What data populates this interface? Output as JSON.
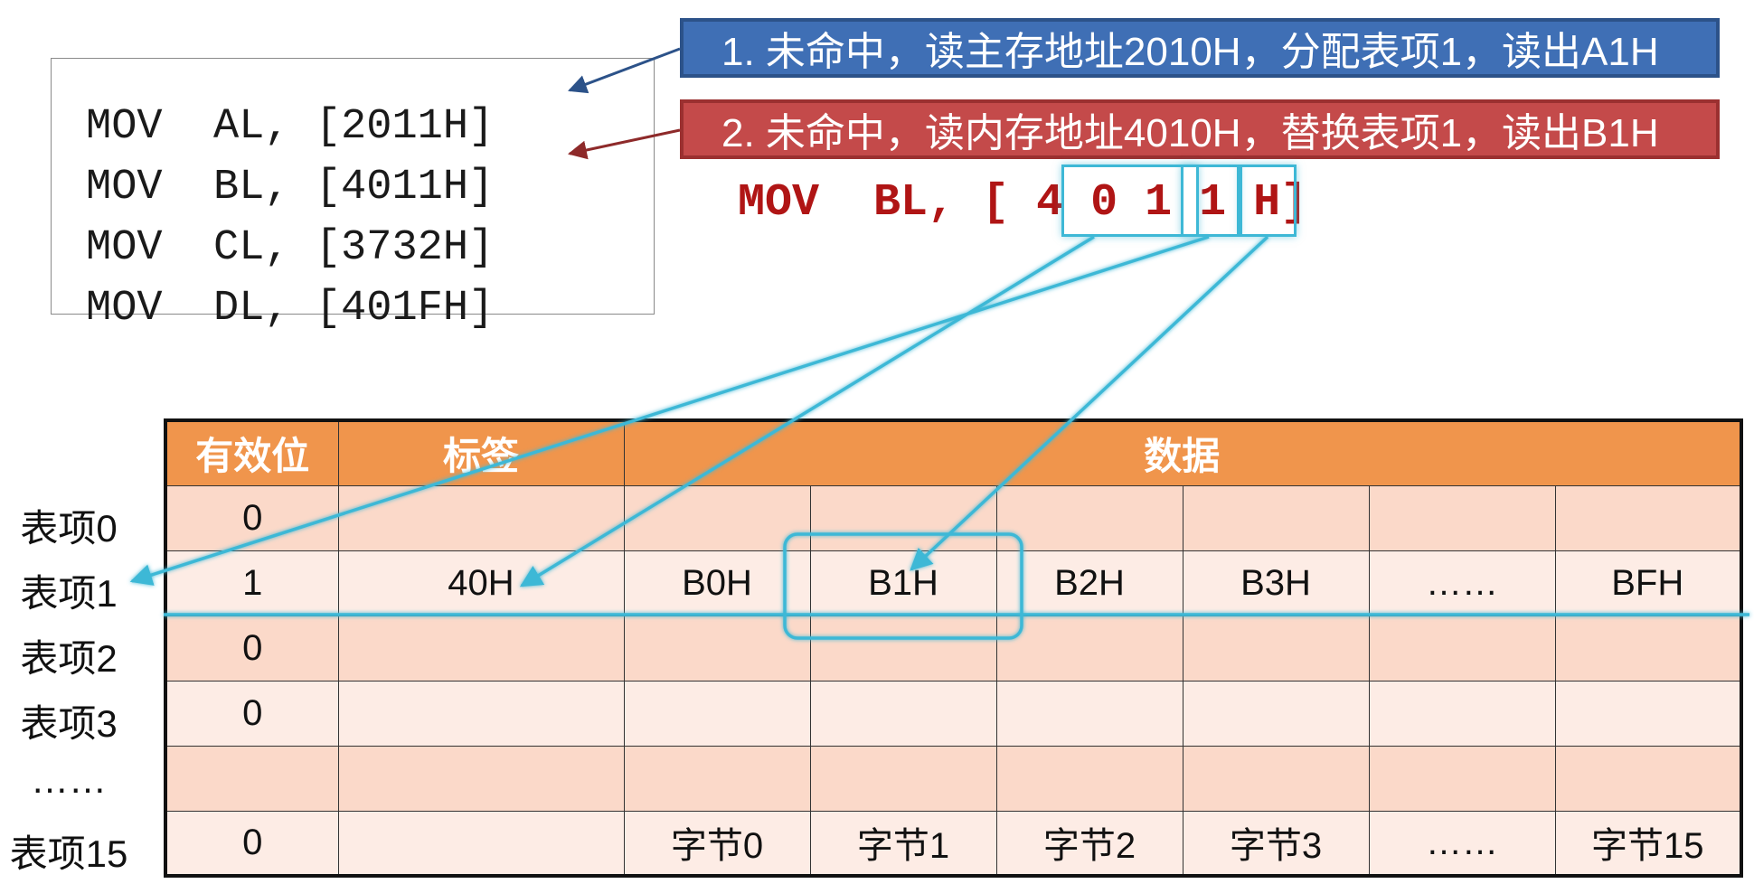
{
  "code_lines": [
    "MOV  AL, [2011H]",
    "MOV  BL, [4011H]",
    "MOV  CL, [3732H]",
    "MOV  DL, [401FH]"
  ],
  "callouts": [
    {
      "text": "1. 未命中，读主存地址2010H，分配表项1，读出A1H",
      "color": "#3f6fb5"
    },
    {
      "text": "2. 未命中，读内存地址4010H，替换表项1，读出B1H",
      "color": "#c44a4a"
    }
  ],
  "instruction": {
    "prefix": "MOV  BL, [",
    "tag_digits": "4 0",
    "index_digit": "1",
    "offset_digit": "1",
    "suffix": "H]"
  },
  "table": {
    "headers": {
      "valid": "有效位",
      "tag": "标签",
      "data": "数据"
    },
    "rows": [
      {
        "label": "表项0",
        "valid": "0",
        "tag": "",
        "data": [
          "",
          "",
          "",
          "",
          "",
          ""
        ]
      },
      {
        "label": "表项1",
        "valid": "1",
        "tag": "40H",
        "data": [
          "B0H",
          "B1H",
          "B2H",
          "B3H",
          "……",
          "BFH"
        ]
      },
      {
        "label": "表项2",
        "valid": "0",
        "tag": "",
        "data": [
          "",
          "",
          "",
          "",
          "",
          ""
        ]
      },
      {
        "label": "表项3",
        "valid": "0",
        "tag": "",
        "data": [
          "",
          "",
          "",
          "",
          "",
          ""
        ]
      },
      {
        "label": "……",
        "valid": "",
        "tag": "",
        "data": [
          "",
          "",
          "",
          "",
          "",
          ""
        ]
      },
      {
        "label": "表项15",
        "valid": "0",
        "tag": "",
        "data": [
          "字节0",
          "字节1",
          "字节2",
          "字节3",
          "……",
          "字节15"
        ]
      }
    ]
  },
  "colors": {
    "header_orange": "#f0954c",
    "cell_peach": "#fbd9c9",
    "highlight_cyan": "#3eb8d6",
    "instruction_red": "#b01515"
  }
}
